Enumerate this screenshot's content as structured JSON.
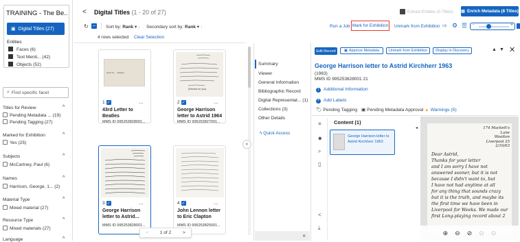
{
  "sidebar": {
    "title": "TRAINING - The Be..",
    "active_item": "Digital Titles (27)",
    "entities_label": "Entities",
    "entities": [
      "Faces (6)",
      "Text Menti...  (42)",
      "Objects (52)"
    ],
    "facet_search_placeholder": "Find specific facet",
    "facets": [
      {
        "title": "Titles for Review",
        "options": [
          "Pending Metadata ... (19)",
          "Pending Tagging (27)"
        ]
      },
      {
        "title": "Marked for Exhibition",
        "options": [
          "Yes (25)"
        ]
      },
      {
        "title": "Subjects",
        "options": [
          "McCartney, Paul (6)"
        ]
      },
      {
        "title": "Names",
        "options": [
          "Harrison, George, 1...  (2)"
        ]
      },
      {
        "title": "Material Type",
        "options": [
          "Mixed material (27)"
        ]
      },
      {
        "title": "Resource Type",
        "options": [
          "Mixed materials (27)"
        ]
      },
      {
        "title": "Language",
        "options": []
      }
    ]
  },
  "header": {
    "back": "<",
    "title": "Digital Titles",
    "count": "(1 - 20 of 27)",
    "extract_button": "Extract Entities (0 Titles)",
    "enrich_button": "Enrich Metadata (8 Titles)"
  },
  "toolbar": {
    "sort_label": "Sort by:",
    "sort_value": "Rank",
    "secondary_sort_label": "Secondary sort by:",
    "secondary_sort_value": "Rank",
    "run_job": "Run a Job",
    "mark_exhibition": "Mark for Exhibition",
    "unmark_exhibition": "Unmark from Exhibition",
    "zoom_minus": "-",
    "zoom_plus": "+",
    "zoom_level": 0.3
  },
  "selection": {
    "rows_selected": "4 rows selected",
    "clear": "Clear Selection"
  },
  "cards": [
    {
      "num": "1",
      "title": "43rd Letter to Beatles",
      "mms": "MMS ID 995253828001...",
      "more": "...",
      "note": "Dear Sir, ... Beatles"
    },
    {
      "num": "2",
      "title": "George Harrison letter to Astrid 1964",
      "mms": "MMS ID 995253827001...",
      "more": "...",
      "note": "(Richard for you)"
    },
    {
      "num": "3",
      "title": "George Harrison letter to Astrid...",
      "mms": "MMS ID 995253828001...",
      "more": "...",
      "note": ""
    },
    {
      "num": "4",
      "title": "John Lennon letter to Eric Clapton",
      "mms": "MMS ID 995253825001...",
      "more": "...",
      "note": ""
    }
  ],
  "pagination": {
    "prev": "<",
    "page": "1 of 2",
    "next": ">"
  },
  "detail_nav": {
    "items": [
      "Summary",
      "Viewer",
      "General Information",
      "Bibliographic Record",
      "Digital Representat... (1)",
      "Collections (3)",
      "Other Details"
    ],
    "quick_access": "Quick Access",
    "collapse": "«"
  },
  "record": {
    "buttons": [
      "Edit Record",
      "Approve Metadata",
      "Unmark from Exhibition",
      "Display in Discovery"
    ],
    "title": "George Harrison letter to Astrid Kirchherr 1963",
    "year": "(1963)",
    "mms_id": "MMS ID 995253828001 21",
    "additional_info": "Additional Information",
    "add_labels": "Add Labels",
    "pending_tagging": "Pending Tagging",
    "pending_metadata": "Pending Metadata Approval",
    "warnings": "Warnings (5)",
    "content_label": "Content (1)",
    "content_item": "George Harrison letter to Astrid Kirchherr 1963"
  },
  "viewer": {
    "letter_lines": [
      "174 Mackett's",
      "Lane",
      "Woolton",
      "Liverpool 25",
      "2/10/63",
      "Dear Astrid,",
      "Thanks for your letter",
      "and I am sorry I have not",
      "answered sooner, but it is not",
      "because I didn't want to, but",
      "I have not had anytime at all",
      "for any thing that sounds crazy",
      "but it is the truth, and maybe its",
      "the first time we have been in",
      "Liverpool for Weeks. We made our",
      "first Long-playing record about 2"
    ]
  },
  "colors": {
    "accent": "#1565c0",
    "warning": "#f9a825",
    "highlight": "#e53935"
  }
}
